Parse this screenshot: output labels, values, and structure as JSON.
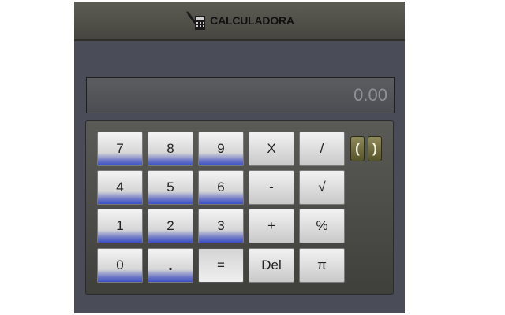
{
  "header": {
    "title": "CALCULADORA",
    "icon": "calculator-pen-icon"
  },
  "display": {
    "value": "0.00"
  },
  "keys": {
    "seven": "7",
    "eight": "8",
    "nine": "9",
    "multiply": "X",
    "divide": "/",
    "four": "4",
    "five": "5",
    "six": "6",
    "minus": "-",
    "sqrt": "√",
    "one": "1",
    "two": "2",
    "three": "3",
    "plus": "+",
    "percent": "%",
    "zero": "0",
    "dot": ".",
    "equals": "=",
    "delete": "Del",
    "pi": "π",
    "open_paren": "(",
    "close_paren": ")"
  },
  "colors": {
    "app_background": "#4a4c57",
    "number_key_accent": "#3a4fc4",
    "paren_key": "#6f6b3c",
    "display_text": "#8f9096"
  }
}
